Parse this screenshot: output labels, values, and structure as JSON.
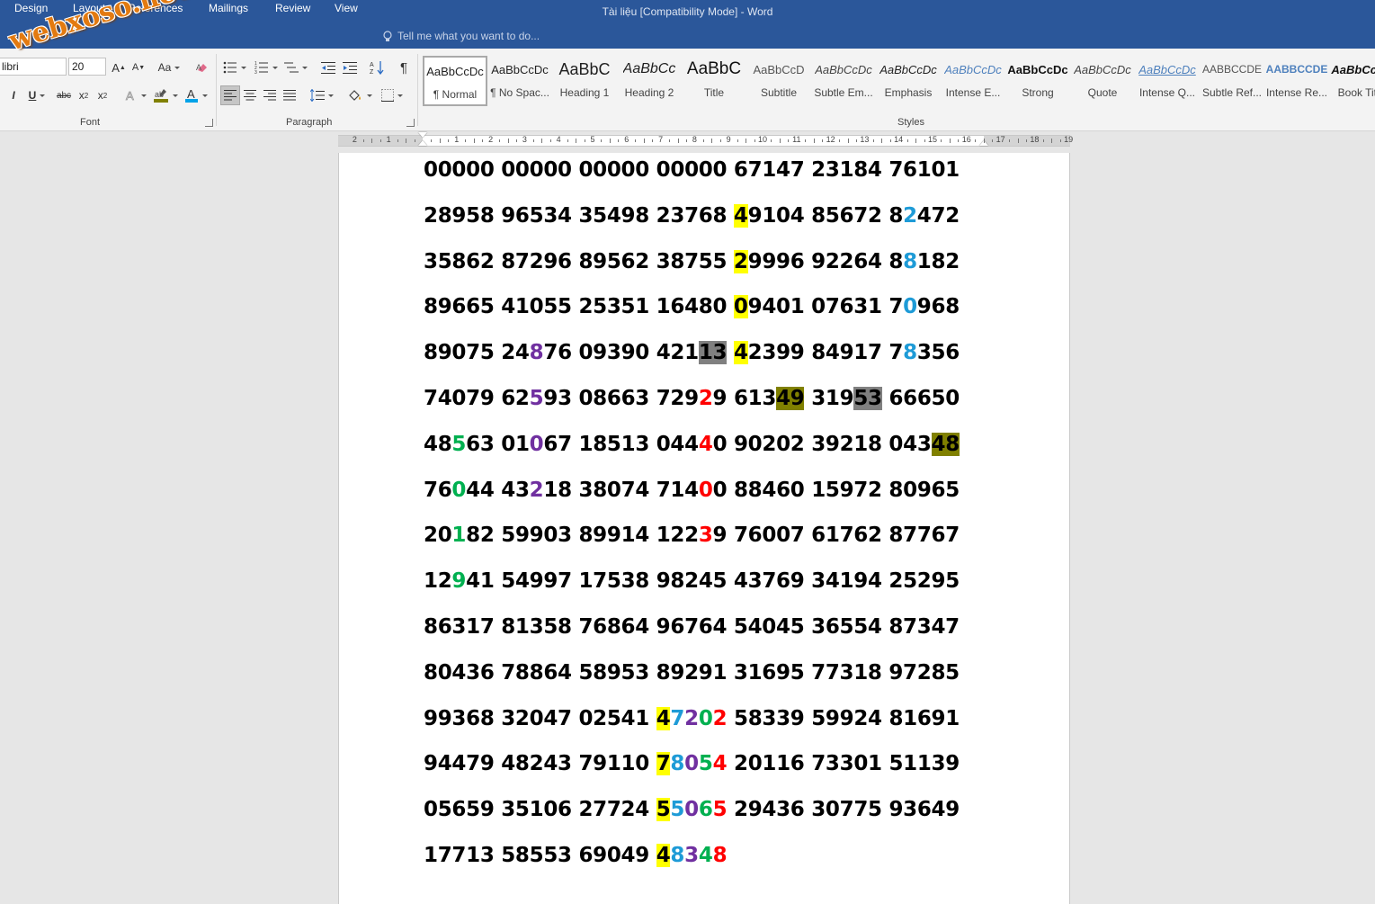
{
  "window": {
    "title": "Tài liệu [Compatibility Mode] - Word"
  },
  "tabs": [
    {
      "label": "Design"
    },
    {
      "label": "Layout"
    },
    {
      "label": "References"
    },
    {
      "label": "Mailings"
    },
    {
      "label": "Review"
    },
    {
      "label": "View"
    }
  ],
  "tell_me": {
    "placeholder": "Tell me what you want to do..."
  },
  "font_group": {
    "label": "Font",
    "font_name": "libri",
    "font_size": "20",
    "buttons": [
      "A",
      "A",
      "Aa",
      "I",
      "U",
      "abc",
      "x",
      "x"
    ]
  },
  "paragraph_group": {
    "label": "Paragraph"
  },
  "styles_group": {
    "label": "Styles",
    "items": [
      {
        "sample": "AaBbCcDc",
        "name": "¶ Normal",
        "selected": true
      },
      {
        "sample": "AaBbCcDc",
        "name": "¶ No Spac..."
      },
      {
        "sample": "AaBbC",
        "name": "Heading 1"
      },
      {
        "sample": "AaBbCc",
        "name": "Heading 2"
      },
      {
        "sample": "AaBbC",
        "name": "Title"
      },
      {
        "sample": "AaBbCcD",
        "name": "Subtitle"
      },
      {
        "sample": "AaBbCcDc",
        "name": "Subtle Em..."
      },
      {
        "sample": "AaBbCcDc",
        "name": "Emphasis"
      },
      {
        "sample": "AaBbCcDc",
        "name": "Intense E..."
      },
      {
        "sample": "AaBbCcDc",
        "name": "Strong"
      },
      {
        "sample": "AaBbCcDc",
        "name": "Quote"
      },
      {
        "sample": "AaBbCcDc",
        "name": "Intense Q..."
      },
      {
        "sample": "AABBCCDE",
        "name": "Subtle Ref..."
      },
      {
        "sample": "AABBCCDE",
        "name": "Intense Re..."
      },
      {
        "sample": "AaBbCcDc",
        "name": "Book Title"
      }
    ]
  },
  "ruler": {
    "numbers": [
      "2",
      "1",
      "1",
      "2",
      "3",
      "4",
      "5",
      "6",
      "7",
      "8",
      "9",
      "10",
      "11",
      "12",
      "13",
      "14",
      "15",
      "16",
      "17",
      "18",
      "19"
    ]
  },
  "watermark": {
    "text": "webxoso.net"
  },
  "document": {
    "lines": [
      [
        {
          "t": "00000 00000 00000 00000 67147 23184 76101"
        }
      ],
      [
        {
          "t": "28958 96534 35498 23768 "
        },
        {
          "t": "4",
          "hl": "#ffff00"
        },
        {
          "t": "9104 85672 8"
        },
        {
          "t": "2",
          "c": "#1e9bd7"
        },
        {
          "t": "472"
        }
      ],
      [
        {
          "t": "35862 87296 89562 38755 "
        },
        {
          "t": "2",
          "hl": "#ffff00"
        },
        {
          "t": "9996 92264 8"
        },
        {
          "t": "8",
          "c": "#1e9bd7"
        },
        {
          "t": "182"
        }
      ],
      [
        {
          "t": "89665 41055 25351 16480 "
        },
        {
          "t": "0",
          "hl": "#ffff00"
        },
        {
          "t": "9401 07631 7"
        },
        {
          "t": "0",
          "c": "#1e9bd7"
        },
        {
          "t": "968"
        }
      ],
      [
        {
          "t": "89075 24"
        },
        {
          "t": "8",
          "c": "#7030a0"
        },
        {
          "t": "76 09390 421"
        },
        {
          "t": "13",
          "hl": "#808080"
        },
        {
          "t": " "
        },
        {
          "t": "4",
          "hl": "#ffff00"
        },
        {
          "t": "2399 84917 7"
        },
        {
          "t": "8",
          "c": "#1e9bd7"
        },
        {
          "t": "356"
        }
      ],
      [
        {
          "t": "74079 62"
        },
        {
          "t": "5",
          "c": "#7030a0"
        },
        {
          "t": "93 08663 729"
        },
        {
          "t": "2",
          "c": "#ff0000"
        },
        {
          "t": "9 613"
        },
        {
          "t": "49",
          "hl": "#808000"
        },
        {
          "t": " 319"
        },
        {
          "t": "53",
          "hl": "#808080"
        },
        {
          "t": " 66650"
        }
      ],
      [
        {
          "t": "48"
        },
        {
          "t": "5",
          "c": "#00b050"
        },
        {
          "t": "63 01"
        },
        {
          "t": "0",
          "c": "#7030a0"
        },
        {
          "t": "67 18513 044"
        },
        {
          "t": "4",
          "c": "#ff0000"
        },
        {
          "t": "0 90202 39218 043"
        },
        {
          "t": "48",
          "hl": "#808000"
        }
      ],
      [
        {
          "t": "76"
        },
        {
          "t": "0",
          "c": "#00b050"
        },
        {
          "t": "44 43"
        },
        {
          "t": "2",
          "c": "#7030a0"
        },
        {
          "t": "18 38074 714"
        },
        {
          "t": "0",
          "c": "#ff0000"
        },
        {
          "t": "0 88460 15972 80965"
        }
      ],
      [
        {
          "t": "20"
        },
        {
          "t": "1",
          "c": "#00b050"
        },
        {
          "t": "82 59903 89914 122"
        },
        {
          "t": "3",
          "c": "#ff0000"
        },
        {
          "t": "9 76007 61762 87767"
        }
      ],
      [
        {
          "t": "12"
        },
        {
          "t": "9",
          "c": "#00b050"
        },
        {
          "t": "41 54997 17538 98245 43769 34194 25295"
        }
      ],
      [
        {
          "t": "86317 81358 76864 96764 54045 36554 87347"
        }
      ],
      [
        {
          "t": "80436 78864 58953 89291 31695 77318 97285"
        }
      ],
      [
        {
          "t": "99368 32047 02541 "
        },
        {
          "t": "4",
          "hl": "#ffff00"
        },
        {
          "t": "7",
          "c": "#1e9bd7"
        },
        {
          "t": "2",
          "c": "#7030a0"
        },
        {
          "t": "0",
          "c": "#00b050"
        },
        {
          "t": "2",
          "c": "#ff0000"
        },
        {
          "t": " 58339 59924 81691"
        }
      ],
      [
        {
          "t": "94479 48243 79110 "
        },
        {
          "t": "7",
          "hl": "#ffff00"
        },
        {
          "t": "8",
          "c": "#1e9bd7"
        },
        {
          "t": "0",
          "c": "#7030a0"
        },
        {
          "t": "5",
          "c": "#00b050"
        },
        {
          "t": "4",
          "c": "#ff0000"
        },
        {
          "t": " 20116 73301 51139"
        }
      ],
      [
        {
          "t": "05659 35106 27724 "
        },
        {
          "t": "5",
          "hl": "#ffff00"
        },
        {
          "t": "5",
          "c": "#1e9bd7"
        },
        {
          "t": "0",
          "c": "#7030a0"
        },
        {
          "t": "6",
          "c": "#00b050"
        },
        {
          "t": "5",
          "c": "#ff0000"
        },
        {
          "t": " 29436 30775 93649"
        }
      ],
      [
        {
          "t": "17713 58553 69049 "
        },
        {
          "t": "4",
          "hl": "#ffff00"
        },
        {
          "t": "8",
          "c": "#1e9bd7"
        },
        {
          "t": "3",
          "c": "#7030a0"
        },
        {
          "t": "4",
          "c": "#00b050"
        },
        {
          "t": "8",
          "c": "#ff0000"
        }
      ]
    ]
  },
  "colors": {
    "title_bar": "#2b579a",
    "ribbon": "#f3f3f3",
    "highlight_yellow": "#ffff00",
    "highlight_gray": "#808080",
    "highlight_olive": "#808000",
    "red": "#ff0000",
    "green": "#00b050",
    "purple": "#7030a0",
    "blue": "#1e9bd7"
  }
}
